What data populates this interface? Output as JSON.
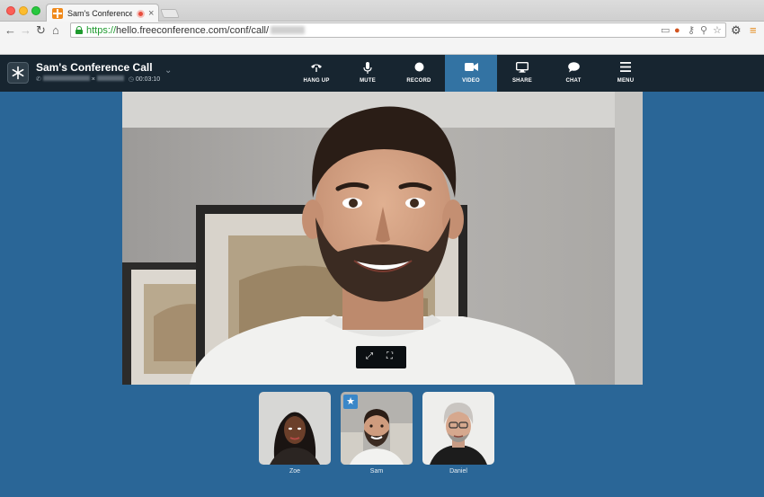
{
  "browser": {
    "tab_title": "Sam's Conference Call",
    "url_scheme": "https://",
    "url_rest": "hello.freeconference.com/conf/call/"
  },
  "header": {
    "call_title": "Sam's Conference Call",
    "call_time": "00:03:10"
  },
  "controls": [
    {
      "label": "HANG UP",
      "icon": "phone-icon"
    },
    {
      "label": "MUTE",
      "icon": "microphone-icon"
    },
    {
      "label": "RECORD",
      "icon": "record-icon"
    },
    {
      "label": "VIDEO",
      "icon": "video-camera-icon",
      "active": true
    },
    {
      "label": "SHARE",
      "icon": "monitor-icon"
    },
    {
      "label": "CHAT",
      "icon": "chat-bubble-icon"
    },
    {
      "label": "MENU",
      "icon": "hamburger-icon"
    }
  ],
  "participants": [
    {
      "name": "Zoe"
    },
    {
      "name": "Sam",
      "starred": true
    },
    {
      "name": "Daniel"
    }
  ],
  "colors": {
    "page_bg": "#2a6697",
    "header_bg": "#172530",
    "active_control": "#3373a3",
    "url_green": "#1e9a2e"
  }
}
